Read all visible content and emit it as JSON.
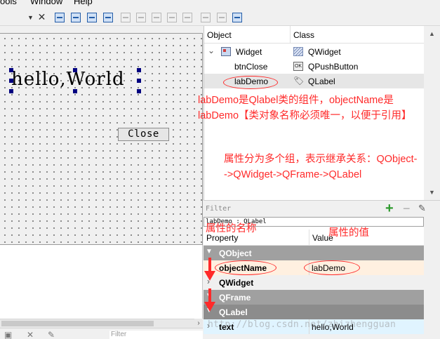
{
  "menu": {
    "items": [
      "ools",
      "Window",
      "Help"
    ]
  },
  "form": {
    "label_text": "hello,World",
    "button_text": "Close"
  },
  "object_inspector": {
    "columns": [
      "Object",
      "Class"
    ],
    "rows": [
      {
        "object": "Widget",
        "class": "QWidget",
        "icon": "widget-icon",
        "class_icon": "qwidget-class-icon",
        "expander": "⌄"
      },
      {
        "object": "btnClose",
        "class": "QPushButton",
        "class_icon": "pushbutton-class-icon"
      },
      {
        "object": "labDemo",
        "class": "QLabel",
        "class_icon": "label-class-icon"
      }
    ]
  },
  "filter": {
    "placeholder": "Filter"
  },
  "object_path": "labDemo : QLabel",
  "property_editor": {
    "columns": [
      "Property",
      "Value"
    ],
    "groups": [
      {
        "name": "QObject"
      },
      {
        "property": "objectName",
        "value": "labDemo"
      },
      {
        "name": "QWidget",
        "collapsed": true
      },
      {
        "name": "QFrame"
      },
      {
        "name": "QLabel"
      },
      {
        "property": "text",
        "value": "hello,World"
      }
    ]
  },
  "bottom_filter_placeholder": "Filter",
  "watermark": "http://blog.csdn.net/zhizhengguan",
  "annotations": {
    "label_note_line1": "labDemo是Qlabel类的组件，objectName是",
    "label_note_line2": "labDemo【类对象名称必须唯一，以便于引用】",
    "inherit_note_line1": "属性分为多个组，表示继承关系：QObject-",
    "inherit_note_line2": "->QWidget->QFrame->QLabel",
    "prop_name_note": "属性的名称",
    "prop_value_note": "属性的值"
  },
  "colors": {
    "annotation": "#ff2a2a",
    "selection_handle": "#000080",
    "group_header": "#a0a0a0",
    "add_button": "#2e9a2e"
  }
}
